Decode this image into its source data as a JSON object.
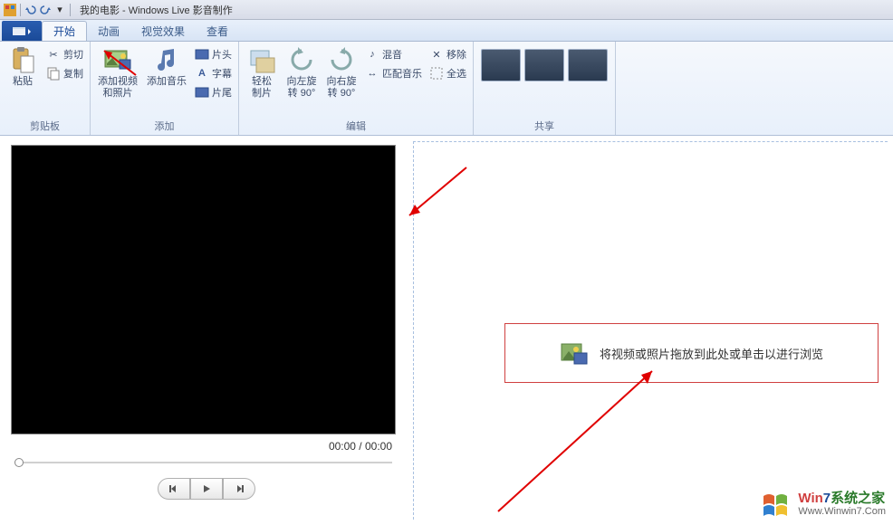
{
  "title": "我的电影 - Windows Live 影音制作",
  "tabs": {
    "home": "开始",
    "anim": "动画",
    "fx": "视觉效果",
    "view": "查看"
  },
  "ribbon": {
    "clipboard": {
      "label": "剪贴板",
      "paste": "粘贴",
      "cut": "剪切",
      "copy": "复制"
    },
    "add": {
      "label": "添加",
      "video": "添加视频\n和照片",
      "music": "添加音乐",
      "title": "片头",
      "caption": "字幕",
      "credits": "片尾"
    },
    "edit": {
      "label": "编辑",
      "easyclip": "轻松\n制片",
      "rotleft": "向左旋\n转 90°",
      "rotright": "向右旋\n转 90°",
      "mix": "混音",
      "fitmusic": "匹配音乐",
      "remove": "移除",
      "selectall": "全选"
    },
    "share": {
      "label": "共享"
    }
  },
  "player": {
    "time": "00:00 / 00:00"
  },
  "drop": {
    "text": "将视频或照片拖放到此处或单击以进行浏览"
  },
  "watermark": {
    "brand_a": "Win",
    "brand_b": "7",
    "brand_c": "系统之家",
    "url": "Www.Winwin7.Com"
  }
}
